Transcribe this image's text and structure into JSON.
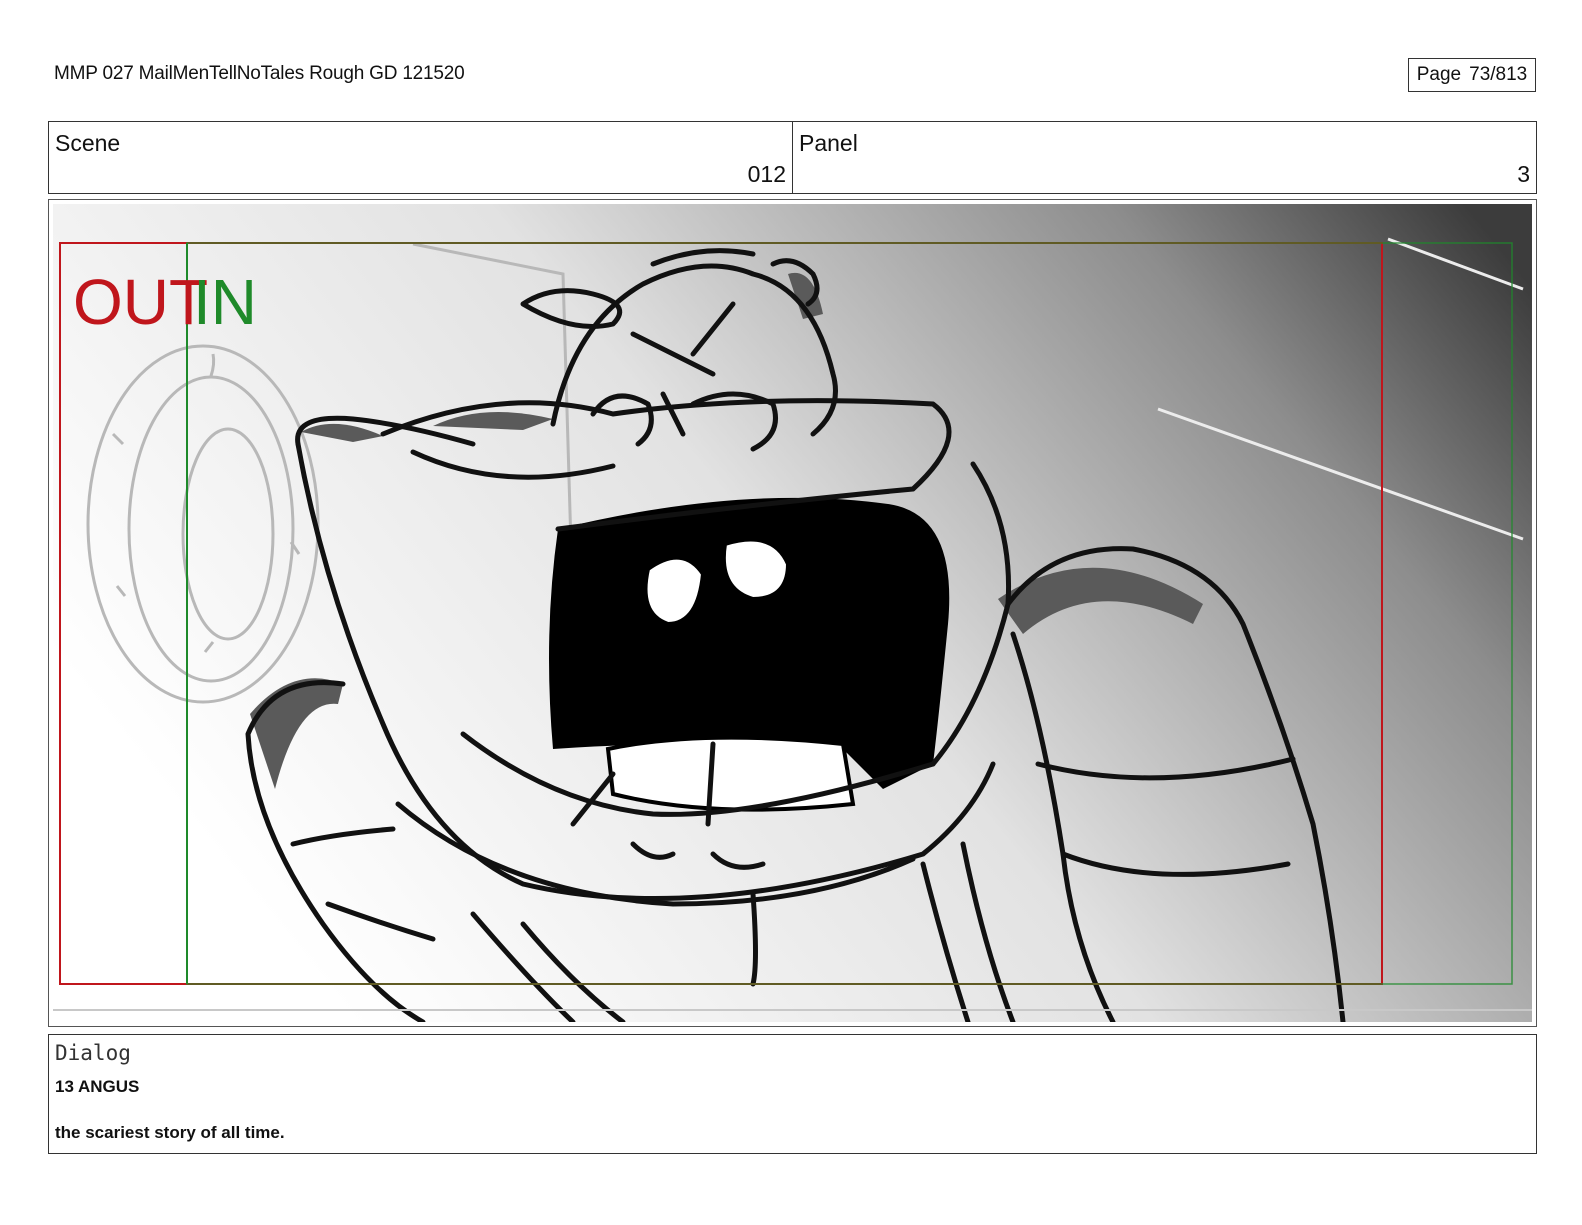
{
  "document": {
    "title": "MMP 027 MailMenTellNoTales Rough GD 121520",
    "page_label": "Page",
    "page_number": "73/813"
  },
  "header": {
    "scene_label": "Scene",
    "scene_value": "012",
    "panel_label": "Panel",
    "panel_value": "3"
  },
  "frame": {
    "out_marker": "OUT",
    "in_marker": "IN",
    "colors": {
      "out_guide": "#c0161c",
      "in_guide": "#1f8a2a"
    }
  },
  "dialog": {
    "label": "Dialog",
    "character": "13 ANGUS",
    "line": "the scariest story of all time."
  }
}
